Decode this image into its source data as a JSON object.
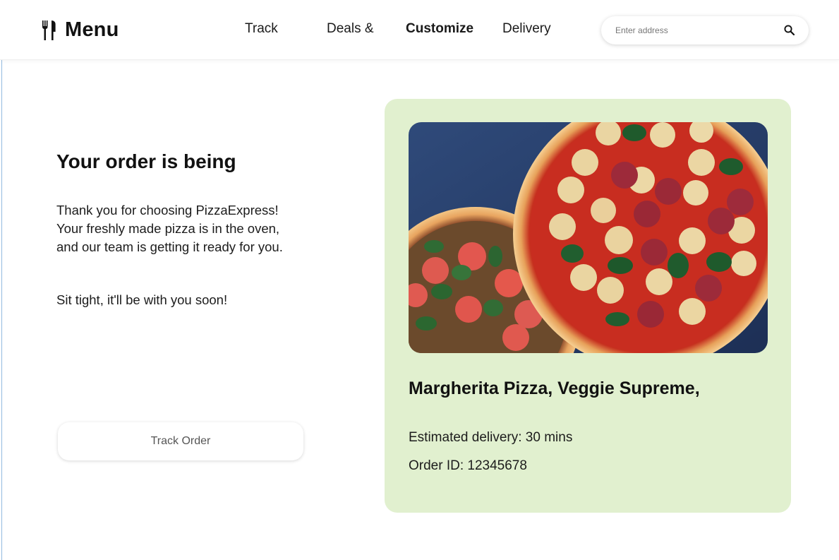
{
  "header": {
    "brand_title": "Menu",
    "brand_icon": "cutlery-icon",
    "nav": [
      {
        "label": "Track",
        "active": false
      },
      {
        "label": "Deals &",
        "active": false
      },
      {
        "label": "Customize",
        "active": true
      },
      {
        "label": "Delivery",
        "active": false
      }
    ],
    "search": {
      "placeholder": "Enter address",
      "value": "",
      "icon": "search-icon"
    }
  },
  "order": {
    "heading": "Your order is being",
    "message_lines": [
      "Thank you for choosing PizzaExpress!",
      "Your freshly made pizza is in the oven,",
      "and our team is getting it ready for you."
    ],
    "tagline": "Sit tight, it'll be with you soon!",
    "track_button": "Track Order"
  },
  "card": {
    "background": "#e1f0cf",
    "image": "pizza-photo",
    "title": "Margherita Pizza, Veggie Supreme,",
    "eta": "Estimated delivery: 30 mins",
    "order_id": "Order ID: 12345678"
  }
}
